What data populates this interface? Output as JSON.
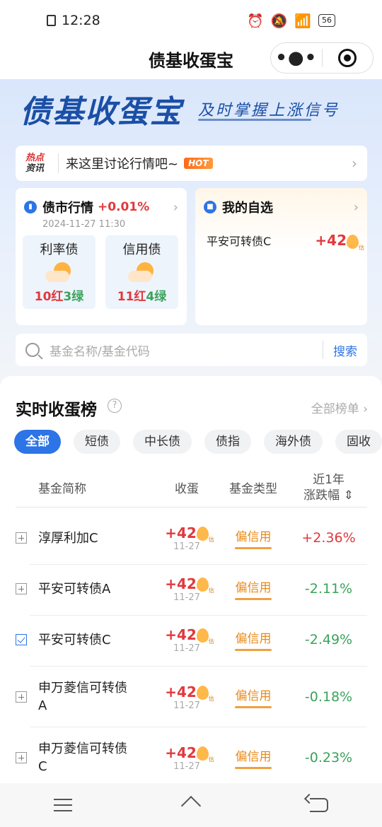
{
  "status": {
    "time": "12:28",
    "battery": "56"
  },
  "nav": {
    "title": "债基收蛋宝"
  },
  "banner": {
    "brand": "债基收蛋宝",
    "slogan": "及时掌握上涨信号"
  },
  "news": {
    "tag_top": "热点",
    "tag_bottom": "资讯",
    "text": "来这里讨论行情吧~",
    "badge": "HOT"
  },
  "market": {
    "title": "债市行情",
    "change": "+0.01%",
    "time": "2024-11-27 11:30",
    "items": [
      {
        "name": "利率债",
        "red": "10红",
        "green": "3绿"
      },
      {
        "name": "信用债",
        "red": "11红",
        "green": "4绿"
      }
    ]
  },
  "watchlist": {
    "title": "我的自选",
    "fund": "平安可转债C",
    "value": "+42",
    "egg_label": "估"
  },
  "search": {
    "placeholder": "基金名称/基金代码",
    "button": "搜索"
  },
  "ranking": {
    "title": "实时收蛋榜",
    "more": "全部榜单",
    "chips": [
      "全部",
      "短债",
      "中长债",
      "债指",
      "海外债",
      "固收"
    ],
    "headers": {
      "name": "基金简称",
      "earn": "收蛋",
      "type": "基金类型",
      "change_line1": "近1年",
      "change_line2": "涨跌幅"
    },
    "rows": [
      {
        "name": "淳厚利加C",
        "earn": "+42",
        "date": "11-27",
        "type": "偏信用",
        "change": "+2.36%",
        "checked": false
      },
      {
        "name": "平安可转债A",
        "earn": "+42",
        "date": "11-27",
        "type": "偏信用",
        "change": "-2.11%",
        "checked": false
      },
      {
        "name": "平安可转债C",
        "earn": "+42",
        "date": "11-27",
        "type": "偏信用",
        "change": "-2.49%",
        "checked": true
      },
      {
        "name": "申万菱信可转债A",
        "earn": "+42",
        "date": "11-27",
        "type": "偏信用",
        "change": "-0.18%",
        "checked": false
      },
      {
        "name": "申万菱信可转债C",
        "earn": "+42",
        "date": "11-27",
        "type": "偏信用",
        "change": "-0.23%",
        "checked": false
      }
    ]
  },
  "colors": {
    "accent": "#2d74e6",
    "up": "#e0393e",
    "down": "#3aa35a",
    "type": "#e88a1a"
  }
}
